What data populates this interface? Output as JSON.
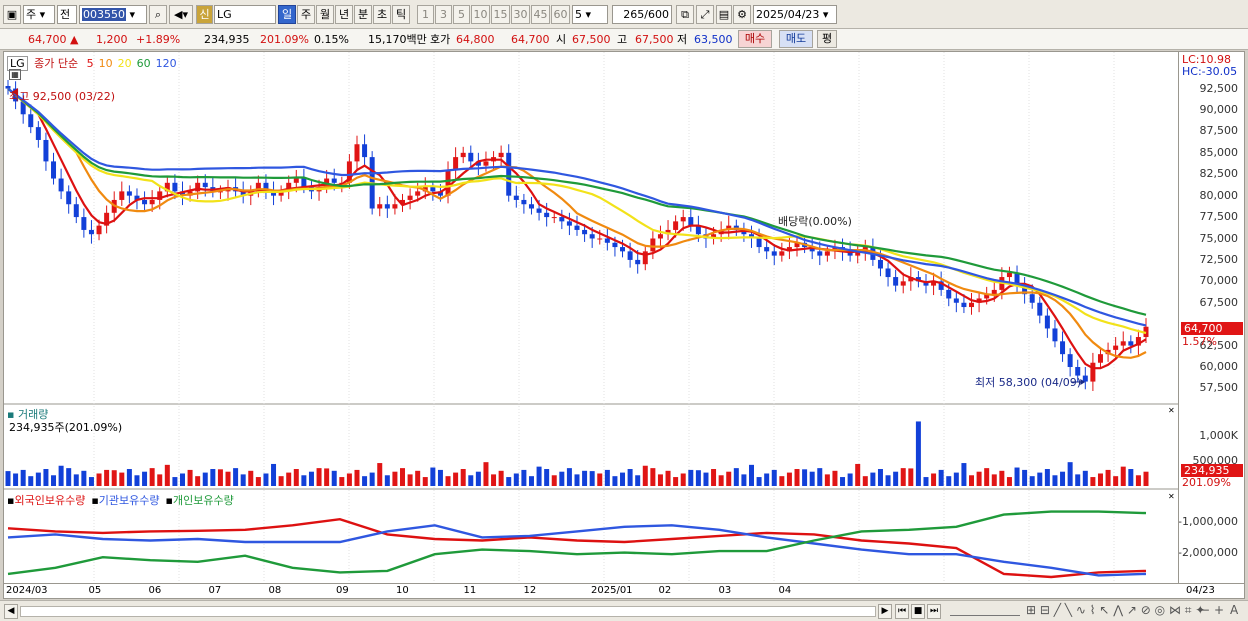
{
  "toolbar": {
    "period": "주",
    "range_mode": "전",
    "stock_code": "003550",
    "market_badge": "신",
    "stock_name": "LG",
    "timeframes": [
      "일",
      "주",
      "월",
      "년",
      "분",
      "초",
      "틱"
    ],
    "active_timeframe_index": 0,
    "intervals": [
      "1",
      "3",
      "5",
      "10",
      "15",
      "30",
      "45",
      "60"
    ],
    "interval_input": "5",
    "count_shown": "265",
    "count_total": "/600",
    "date": "2025/04/23"
  },
  "infobar": {
    "price": "64,700",
    "change_arrow": "▲",
    "change": "1,200",
    "change_pct": "+1.89%",
    "volume": "234,935",
    "volume_ratio": "201.09%",
    "turnover_pct": "0.15%",
    "amount": "15,170백만",
    "quote_label": "호가",
    "bid": "64,800",
    "ask": "64,700",
    "open_label": "시",
    "open": "67,500",
    "high_label": "고",
    "high": "67,500",
    "low_label": "저",
    "low": "63,500",
    "buy_btn": "매수",
    "sell_btn": "매도",
    "eval_btn": "평"
  },
  "price_pane": {
    "symbol": "LG",
    "legend_title": "종가 단순",
    "ma_periods": [
      "5",
      "10",
      "20",
      "60",
      "120"
    ],
    "ma_colors": [
      "#dd1111",
      "#f08a10",
      "#f2e21a",
      "#1f9a3a",
      "#2f57e0"
    ],
    "high_annotation": "최고 92,500 (03/22)",
    "low_annotation": "최저 58,300 (04/09)",
    "event_annotation": "배당락(0.00%)",
    "scale_top_1": "LC:10.98",
    "scale_top_2": "HC:-30.05",
    "price_ticks": [
      "92,500",
      "90,000",
      "87,500",
      "85,000",
      "82,500",
      "80,000",
      "77,500",
      "75,000",
      "72,500",
      "70,000",
      "67,500",
      "62,500",
      "60,000",
      "57,500"
    ],
    "current_price_tag": "64,700",
    "current_change_tag": "1.57%"
  },
  "volume_pane": {
    "title": "거래량",
    "value": "234,935주(201.09%)",
    "ticks": [
      "1,000K",
      "500,000"
    ],
    "current_tag": "234,935",
    "current_pct": "201.09%"
  },
  "holdings_pane": {
    "series_labels": [
      "외국인보유수량",
      "기관보유수량",
      "개인보유수량"
    ],
    "series_colors": [
      "#dd1111",
      "#2f57e0",
      "#1f9a3a"
    ],
    "ticks": [
      "-1,000,000",
      "-2,000,000"
    ]
  },
  "date_axis": {
    "labels": [
      "2024/03",
      "05",
      "06",
      "07",
      "08",
      "09",
      "10",
      "11",
      "12",
      "2025/01",
      "02",
      "03",
      "04"
    ],
    "right_label": "04/23"
  },
  "chart_data": {
    "type": "candlestick",
    "x_range": [
      "2024/03",
      "2025/04/23"
    ],
    "ylim": [
      56500,
      93500
    ],
    "closes": [
      92500,
      91000,
      89500,
      88000,
      86500,
      84000,
      82000,
      80500,
      79000,
      77500,
      76000,
      75500,
      76500,
      78000,
      79500,
      80500,
      80000,
      79500,
      79000,
      79500,
      80500,
      81500,
      80500,
      80000,
      80500,
      81500,
      81000,
      80500,
      80500,
      81000,
      80500,
      80000,
      80500,
      81500,
      80500,
      80000,
      80500,
      81500,
      82000,
      81000,
      80500,
      81000,
      82000,
      81500,
      81500,
      84000,
      86000,
      84500,
      78500,
      79000,
      78500,
      79000,
      79500,
      80000,
      80500,
      81000,
      80500,
      80000,
      83000,
      84500,
      85000,
      84000,
      83500,
      84000,
      84500,
      85000,
      80000,
      79500,
      79000,
      78500,
      78000,
      77500,
      77500,
      77000,
      76500,
      76000,
      75500,
      75000,
      75000,
      74500,
      74000,
      73500,
      72500,
      72000,
      73500,
      75000,
      75500,
      76000,
      77000,
      77500,
      76500,
      75500,
      75000,
      75500,
      76000,
      76500,
      76000,
      75500,
      75000,
      74000,
      73500,
      73000,
      73500,
      74000,
      74500,
      74000,
      73500,
      73000,
      73500,
      74000,
      73500,
      73000,
      73500,
      74000,
      72500,
      71500,
      70500,
      69500,
      70000,
      70500,
      70000,
      69500,
      70000,
      69000,
      68000,
      67500,
      67000,
      67500,
      68000,
      68500,
      69000,
      70500,
      71000,
      69500,
      68500,
      67500,
      66000,
      64500,
      63000,
      61500,
      60000,
      59000,
      58300,
      60500,
      61500,
      62000,
      62500,
      63000,
      62500,
      63500,
      64700
    ],
    "ma_series": [
      {
        "name": "5",
        "period": 5
      },
      {
        "name": "10",
        "period": 10
      },
      {
        "name": "20",
        "period": 20
      },
      {
        "name": "60",
        "period": 60
      },
      {
        "name": "120",
        "period": 120
      }
    ],
    "volume_ylim": [
      0,
      1450000
    ],
    "volume_spike_index": 120,
    "volume_spike_value": 1300000,
    "holdings_ylim": [
      -2900000,
      -400000
    ],
    "holdings_series": [
      {
        "name": "외국인보유수량",
        "values": [
          -1200000,
          -1300000,
          -1350000,
          -1300000,
          -1280000,
          -1250000,
          -1100000,
          -900000,
          -1400000,
          -1550000,
          -1600000,
          -1500000,
          -1600000,
          -1650000,
          -1550000,
          -1450000,
          -1350000,
          -1400000,
          -1600000,
          -1700000,
          -1850000,
          -2700000,
          -2800000,
          -2650000,
          -2600000
        ]
      },
      {
        "name": "기관보유수량",
        "values": [
          -1500000,
          -1400000,
          -1550000,
          -1600000,
          -1550000,
          -1650000,
          -1650000,
          -1650000,
          -1300000,
          -1100000,
          -1500000,
          -1450000,
          -1300000,
          -1150000,
          -1100000,
          -1250000,
          -1500000,
          -1700000,
          -1900000,
          -2050000,
          -2050000,
          -2300000,
          -2500000,
          -2750000,
          -2700000
        ]
      },
      {
        "name": "개인보유수량",
        "values": [
          -2700000,
          -2500000,
          -2150000,
          -2250000,
          -2300000,
          -2100000,
          -2500000,
          -2650000,
          -2600000,
          -2050000,
          -1900000,
          -1950000,
          -2050000,
          -2000000,
          -2050000,
          -1950000,
          -1950000,
          -1600000,
          -1300000,
          -1250000,
          -1150000,
          -750000,
          -650000,
          -650000,
          -700000
        ]
      }
    ]
  }
}
